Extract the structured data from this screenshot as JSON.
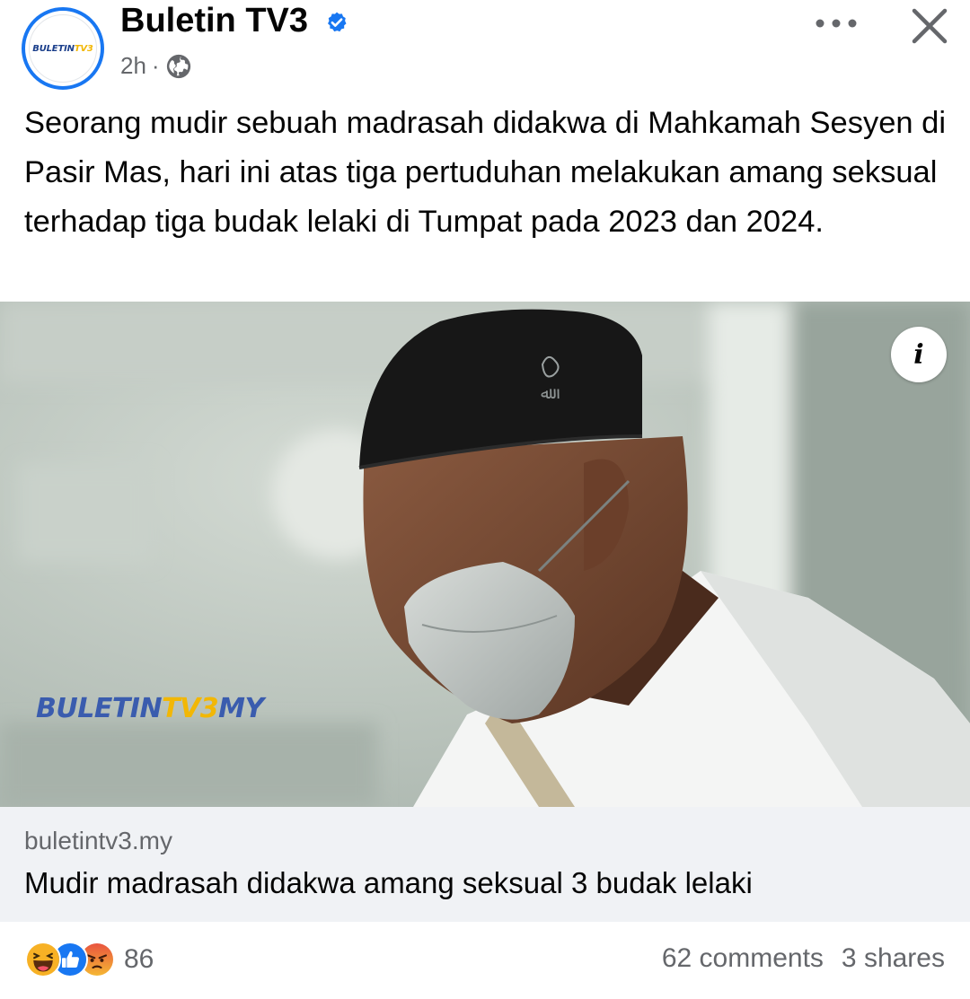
{
  "post": {
    "page_name": "Buletin TV3",
    "avatar_text": "BULETINTV3",
    "avatar_text_main": "BULETIN",
    "avatar_text_accent": "TV3",
    "time": "2h",
    "separator": "·",
    "privacy_icon": "globe-icon",
    "verified_icon": "verified-badge-icon",
    "text": "Seorang mudir sebuah madrasah didakwa di Mahkamah Sesyen di Pasir Mas, hari ini atas tiga pertuduhan melakukan amang seksual terhadap tiga budak lelaki di Tumpat pada 2023 dan 2024."
  },
  "header_actions": {
    "more_icon": "more-horizontal-icon",
    "close_icon": "close-icon"
  },
  "photo": {
    "watermark_main": "BULETIN",
    "watermark_tv3": "TV3",
    "watermark_suffix": "MY",
    "info_label": "i"
  },
  "link": {
    "domain": "buletintv3.my",
    "title": "Mudir madrasah didakwa amang seksual 3 budak lelaki"
  },
  "engagement": {
    "reaction_icons": [
      "haha-reaction-icon",
      "like-reaction-icon",
      "angry-reaction-icon"
    ],
    "reaction_count": "86",
    "comments": "62 comments",
    "shares": "3 shares"
  },
  "colors": {
    "brand_blue": "#1877f2",
    "text_primary": "#050505",
    "text_secondary": "#65676b",
    "card_bg": "#f0f2f5",
    "watermark_blue": "#3a5cae",
    "watermark_yellow": "#f2b705"
  }
}
